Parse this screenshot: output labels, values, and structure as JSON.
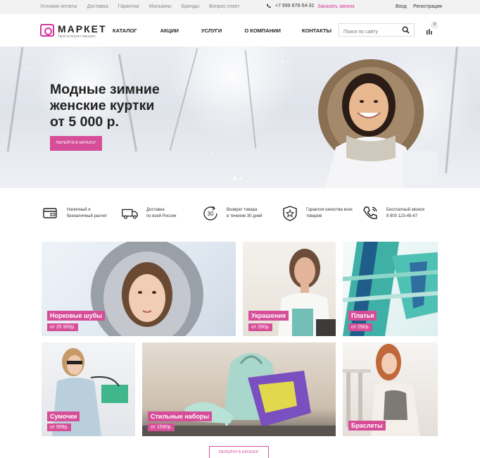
{
  "topbar": {
    "links": [
      "Условия оплаты",
      "Доставка",
      "Гарантии",
      "Магазины",
      "Бренды",
      "Вопрос-ответ"
    ],
    "phone": "+7 999 876-54-32",
    "callback": "Заказать звонок",
    "login": "Вход",
    "register": "Регистрация"
  },
  "header": {
    "logo_name": "МАРКЕТ",
    "logo_sub": "Твой интернет-магазин",
    "nav": [
      "КАТАЛОГ",
      "АКЦИИ",
      "УСЛУГИ",
      "О КОМПАНИИ",
      "КОНТАКТЫ"
    ],
    "search_placeholder": "Поиск по сайту",
    "cart_count": "0"
  },
  "hero": {
    "title_lines": [
      "Модные зимние",
      "женские куртки",
      "от 5 000 р."
    ],
    "button": "ПЕРЕЙТИ В КАТАЛОГ",
    "slides": 2,
    "active_slide": 1
  },
  "features": [
    {
      "icon": "card-icon",
      "lines": [
        "Наличный и",
        "безналичный расчет"
      ]
    },
    {
      "icon": "truck-icon",
      "lines": [
        "Доставка",
        "по всей России"
      ]
    },
    {
      "icon": "return-30-icon",
      "lines": [
        "Возврат товара",
        "в течение 30 дней"
      ]
    },
    {
      "icon": "quality-star-icon",
      "lines": [
        "Гарантия качества всех",
        "товаров"
      ]
    },
    {
      "icon": "phone-icon",
      "lines": [
        "Бесплатный звонок",
        "8 800 123-45-67"
      ]
    }
  ],
  "tiles": [
    {
      "label": "Норковые шубы",
      "price": "от 25 900р."
    },
    {
      "label": "Украшения",
      "price": "от 290р."
    },
    {
      "label": "Платья",
      "price": "от 290р."
    },
    {
      "label": "Сумочки",
      "price": "от 999р."
    },
    {
      "label": "Стильные наборы",
      "price": "от 1590р."
    },
    {
      "label": "Браслеты",
      "price": ""
    }
  ],
  "catalog_button": "ПЕРЕЙТИ В КАТАЛОГ",
  "colors": {
    "accent": "#d64d98",
    "accent_text": "#d633a0"
  }
}
